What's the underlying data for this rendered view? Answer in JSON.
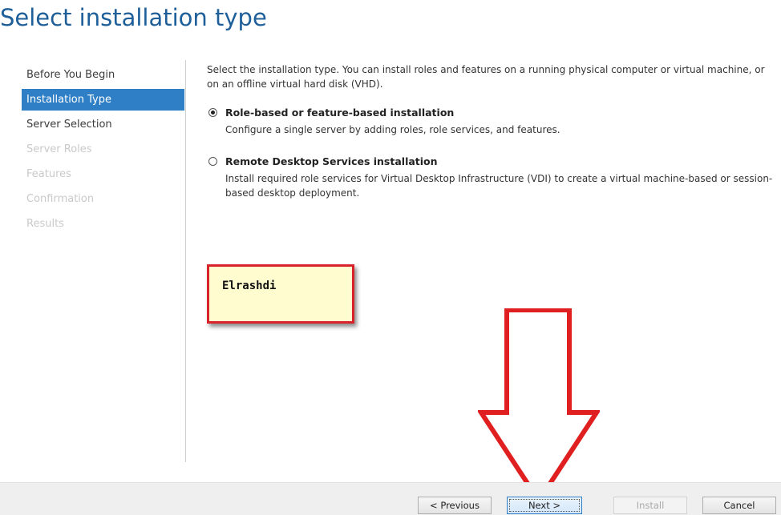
{
  "title": "Select installation type",
  "nav": {
    "items": [
      {
        "label": "Before You Begin",
        "state": "normal"
      },
      {
        "label": "Installation Type",
        "state": "selected"
      },
      {
        "label": "Server Selection",
        "state": "normal"
      },
      {
        "label": "Server Roles",
        "state": "disabled"
      },
      {
        "label": "Features",
        "state": "disabled"
      },
      {
        "label": "Confirmation",
        "state": "disabled"
      },
      {
        "label": "Results",
        "state": "disabled"
      }
    ]
  },
  "content": {
    "description": "Select the installation type. You can install roles and features on a running physical computer or virtual machine, or on an offline virtual hard disk (VHD).",
    "options": [
      {
        "title": "Role-based or feature-based installation",
        "description": "Configure a single server by adding roles, role services, and features.",
        "selected": true
      },
      {
        "title": "Remote Desktop Services installation",
        "description": "Install required role services for Virtual Desktop Infrastructure (VDI) to create a virtual machine-based or session-based desktop deployment.",
        "selected": false
      }
    ]
  },
  "watermark": {
    "text": "Elrashdi"
  },
  "annotation": {
    "icon": "down-arrow-icon",
    "color": "#e02020"
  },
  "footer": {
    "previous_label": "< Previous",
    "next_label": "Next >",
    "install_label": "Install",
    "cancel_label": "Cancel"
  },
  "colors": {
    "accent": "#2f7fc7",
    "title": "#1e5f9a",
    "watermark_border": "#d9232a",
    "watermark_bg": "#fffdd0"
  }
}
